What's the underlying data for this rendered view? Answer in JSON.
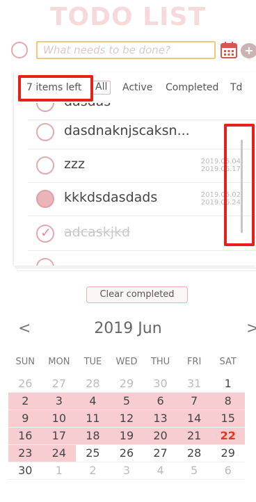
{
  "app": {
    "title": "TODO LIST"
  },
  "input": {
    "placeholder": "What needs to be done?",
    "value": ""
  },
  "filters": {
    "count_text": "7 items left",
    "all": "All",
    "active": "Active",
    "completed": "Completed",
    "todo_partial": "Td"
  },
  "todos": [
    {
      "label": "dasdas",
      "state": "active",
      "dates": [
        "",
        ""
      ]
    },
    {
      "label": "dasdnaknjscaksn...",
      "state": "active",
      "dates": [
        "",
        ""
      ]
    },
    {
      "label": "zzz",
      "state": "active",
      "dates": [
        "2019.06.04",
        "2019.06.17"
      ]
    },
    {
      "label": "kkkdsdasdads",
      "state": "active-filled",
      "dates": [
        "2019.06.02",
        "2019.06.24"
      ]
    },
    {
      "label": "adcaskjkd",
      "state": "completed",
      "dates": [
        "",
        ""
      ]
    }
  ],
  "clear_completed": "Clear completed",
  "calendar": {
    "prev": "<",
    "next": ">",
    "month_label": "2019 Jun",
    "weekdays": [
      "SUN",
      "MON",
      "TUE",
      "WED",
      "THU",
      "FRI",
      "SAT"
    ],
    "weeks": [
      [
        {
          "d": "26",
          "o": true
        },
        {
          "d": "27",
          "o": true
        },
        {
          "d": "28",
          "o": true
        },
        {
          "d": "29",
          "o": true
        },
        {
          "d": "30",
          "o": true
        },
        {
          "d": "31",
          "o": true
        },
        {
          "d": "1"
        }
      ],
      [
        {
          "d": "2",
          "h": true
        },
        {
          "d": "3",
          "h": true
        },
        {
          "d": "4",
          "h": true
        },
        {
          "d": "5",
          "h": true
        },
        {
          "d": "6",
          "h": true
        },
        {
          "d": "7",
          "h": true
        },
        {
          "d": "8",
          "h": true
        }
      ],
      [
        {
          "d": "9",
          "h": true
        },
        {
          "d": "10",
          "h": true
        },
        {
          "d": "11",
          "h": true
        },
        {
          "d": "12",
          "h": true
        },
        {
          "d": "13",
          "h": true
        },
        {
          "d": "14",
          "h": true
        },
        {
          "d": "15",
          "h": true
        }
      ],
      [
        {
          "d": "16",
          "h": true
        },
        {
          "d": "17",
          "h": true
        },
        {
          "d": "18",
          "h": true
        },
        {
          "d": "19",
          "h": true
        },
        {
          "d": "20",
          "h": true
        },
        {
          "d": "21",
          "h": true
        },
        {
          "d": "22",
          "h": true,
          "t": true
        }
      ],
      [
        {
          "d": "23",
          "h": true
        },
        {
          "d": "24",
          "h": true
        },
        {
          "d": "25"
        },
        {
          "d": "26"
        },
        {
          "d": "27"
        },
        {
          "d": "28"
        },
        {
          "d": "29"
        }
      ],
      [
        {
          "d": "30"
        },
        {
          "d": "1",
          "o": true
        },
        {
          "d": "2",
          "o": true
        },
        {
          "d": "3",
          "o": true
        },
        {
          "d": "4",
          "o": true
        },
        {
          "d": "5",
          "o": true
        },
        {
          "d": "6",
          "o": true
        }
      ]
    ]
  }
}
